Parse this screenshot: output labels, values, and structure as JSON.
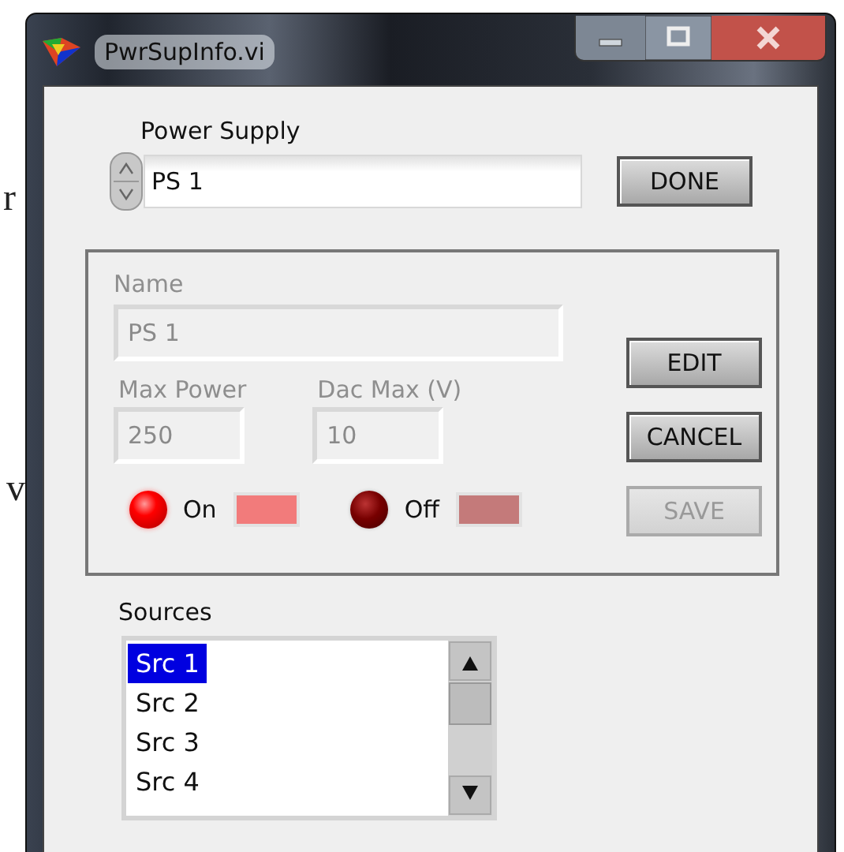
{
  "background_text": [
    "r",
    "v"
  ],
  "window": {
    "title": "PwrSupInfo.vi"
  },
  "power_supply": {
    "label": "Power Supply",
    "value": "PS 1"
  },
  "done_button": {
    "label": "DONE",
    "disabled": false
  },
  "details": {
    "name": {
      "label": "Name",
      "value": "PS 1",
      "disabled": true
    },
    "max_power": {
      "label": "Max Power",
      "value": "250",
      "disabled": true
    },
    "dac_max": {
      "label": "Dac Max (V)",
      "value": "10",
      "disabled": true
    },
    "indicators": [
      {
        "label": "On",
        "on": true,
        "color": "#f27b7b"
      },
      {
        "label": "Off",
        "on": false,
        "color": "#c47a7a"
      }
    ],
    "buttons": [
      {
        "label": "EDIT",
        "disabled": false
      },
      {
        "label": "CANCEL",
        "disabled": false
      },
      {
        "label": "SAVE",
        "disabled": true
      }
    ]
  },
  "sources": {
    "label": "Sources",
    "items": [
      {
        "label": "Src 1",
        "selected": true
      },
      {
        "label": "Src 2",
        "selected": false
      },
      {
        "label": "Src 3",
        "selected": false
      },
      {
        "label": "Src 4",
        "selected": false
      }
    ]
  }
}
